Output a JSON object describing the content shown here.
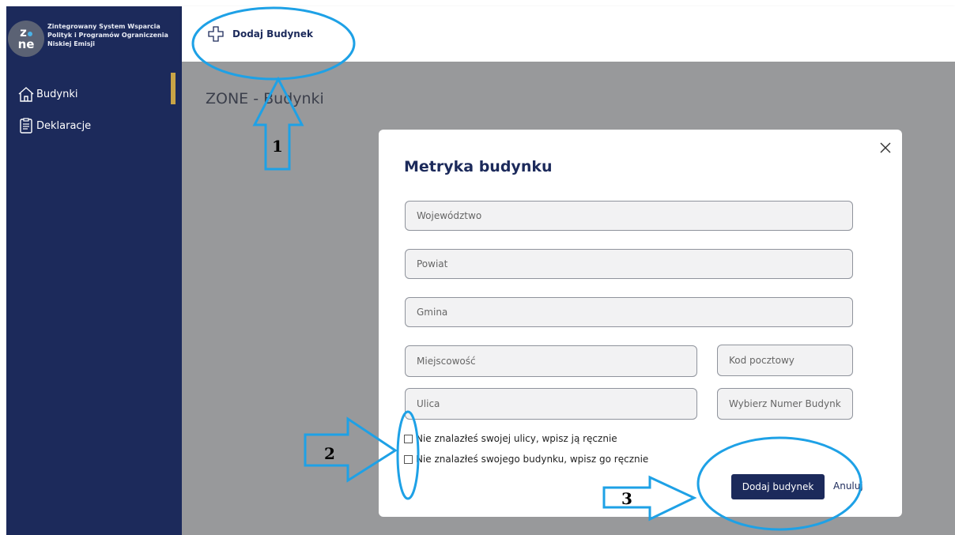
{
  "brand": {
    "logo_text_top": "z",
    "logo_text_bottom": "ne",
    "title": "Zintegrowany System Wsparcia Polityk i Programów Ograniczenia Niskiej Emisji"
  },
  "sidebar": {
    "items": [
      {
        "label": "Budynki",
        "icon": "home-icon",
        "active": true
      },
      {
        "label": "Deklaracje",
        "icon": "clipboard-icon",
        "active": false
      }
    ]
  },
  "topbar": {
    "add_label": "Dodaj Budynek",
    "add_icon": "plus-icon"
  },
  "page": {
    "title": "ZONE - Budynki"
  },
  "modal": {
    "title": "Metryka budynku",
    "fields": {
      "wojewodztwo": {
        "placeholder": "Województwo",
        "value": ""
      },
      "powiat": {
        "placeholder": "Powiat",
        "value": ""
      },
      "gmina": {
        "placeholder": "Gmina",
        "value": ""
      },
      "miejscowosc": {
        "placeholder": "Miejscowość",
        "value": ""
      },
      "kod": {
        "placeholder": "Kod pocztowy",
        "value": ""
      },
      "ulica": {
        "placeholder": "Ulica",
        "value": ""
      },
      "numer": {
        "placeholder": "Wybierz Numer Budynku",
        "value": ""
      }
    },
    "checkboxes": [
      {
        "label": "Nie znalazłeś swojej ulicy, wpisz ją ręcznie",
        "checked": false
      },
      {
        "label": "Nie znalazłeś swojego budynku, wpisz go ręcznie",
        "checked": false
      }
    ],
    "submit_label": "Dodaj budynek",
    "cancel_label": "Anuluj"
  },
  "annotations": {
    "step1": "1",
    "step2": "2",
    "step3": "3",
    "color": "#1ea1e6"
  },
  "colors": {
    "sidebar": "#1c2a5b",
    "accent": "#c9a446",
    "overlay": "#98999b",
    "primary": "#1c2a5b"
  }
}
